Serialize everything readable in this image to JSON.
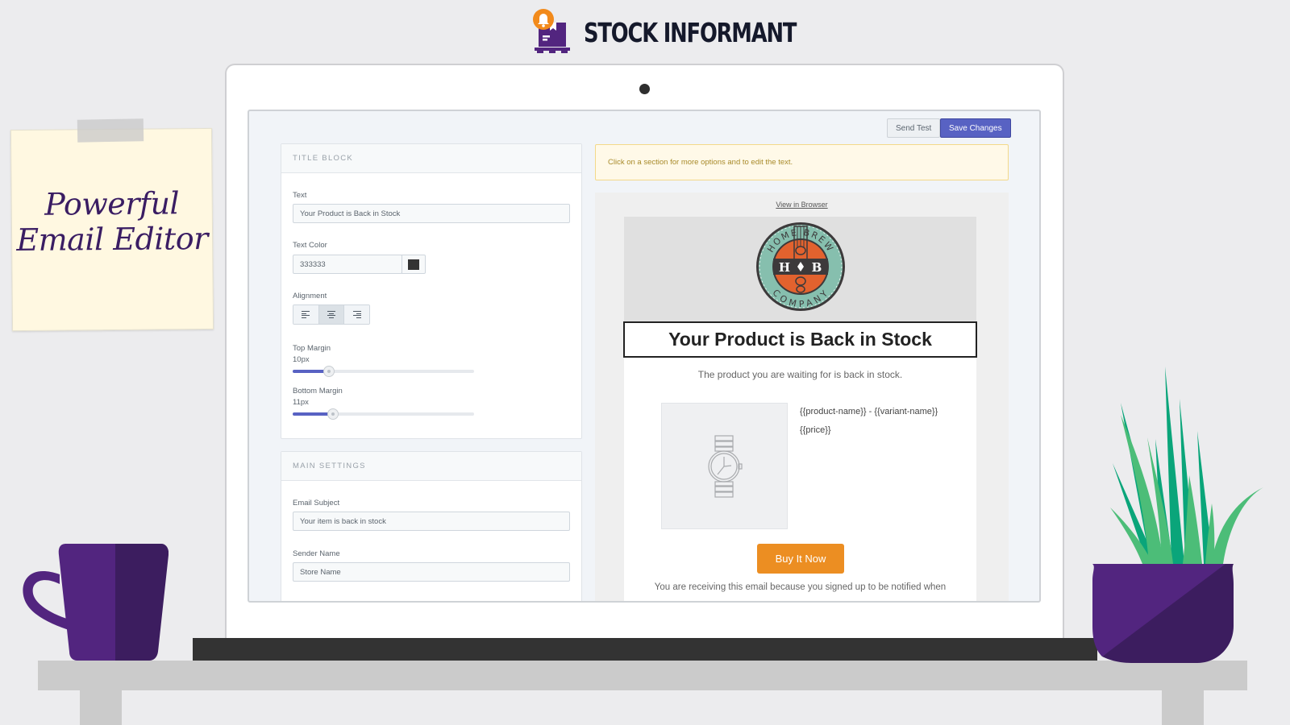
{
  "brand": {
    "name": "STOCK INFORMANT",
    "colors": {
      "purple": "#52257f",
      "orange": "#f28a1b",
      "dark": "#15192b"
    }
  },
  "sticky_note": {
    "line1": "Powerful",
    "line2": "Email Editor"
  },
  "toolbar": {
    "send_test_label": "Send Test",
    "save_changes_label": "Save Changes"
  },
  "title_block": {
    "heading": "TITLE BLOCK",
    "text_label": "Text",
    "text_value": "Your Product is Back in Stock",
    "text_color_label": "Text Color",
    "text_color_value": "333333",
    "text_color_hex": "#333333",
    "alignment_label": "Alignment",
    "alignment_options": [
      "left",
      "center",
      "right"
    ],
    "alignment_selected": "center",
    "top_margin_label": "Top Margin",
    "top_margin_value": "10px",
    "top_margin_fraction": 0.2,
    "bottom_margin_label": "Bottom Margin",
    "bottom_margin_value": "11px",
    "bottom_margin_fraction": 0.22
  },
  "main_settings": {
    "heading": "MAIN SETTINGS",
    "email_subject_label": "Email Subject",
    "email_subject_value": "Your item is back in stock",
    "sender_name_label": "Sender Name",
    "sender_name_value": "Store Name"
  },
  "notice": {
    "text": "Click on a section for more options and to edit the text."
  },
  "email_preview": {
    "view_in_browser": "View in Browser",
    "logo": {
      "top_text": "HOME BREW",
      "bottom_text": "COMPANY",
      "initials_left": "H",
      "initials_right": "B"
    },
    "title": "Your Product is Back in Stock",
    "subtitle": "The product you are waiting for is back in stock.",
    "product_line": "{{product-name}} - {{variant-name}}",
    "price_line": "{{price}}",
    "buy_button": "Buy It Now",
    "buy_button_color": "#ec8e22",
    "footer": "You are receiving this email because you signed up to be notified when"
  }
}
